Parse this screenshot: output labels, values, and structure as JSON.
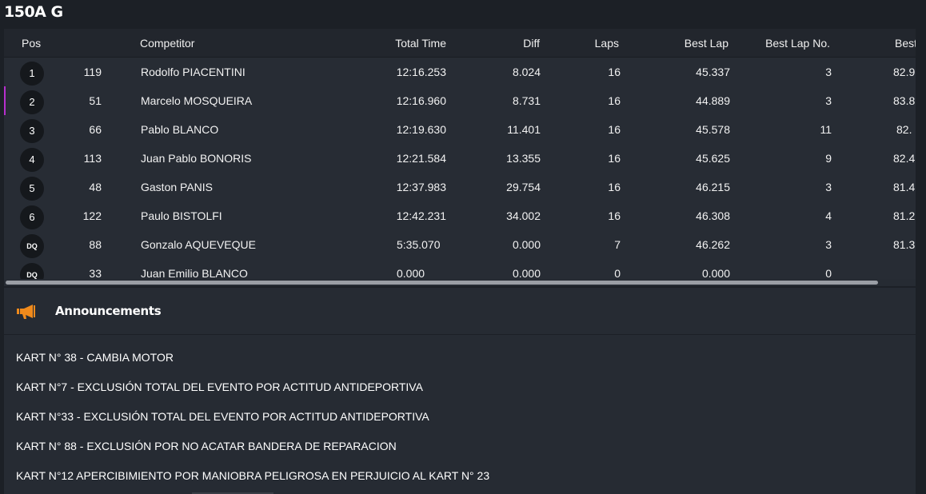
{
  "title": "150A G",
  "table": {
    "headers": {
      "pos": "Pos",
      "competitor": "Competitor",
      "total_time": "Total Time",
      "diff": "Diff",
      "laps": "Laps",
      "best_lap": "Best Lap",
      "best_lap_no": "Best Lap No.",
      "best_speed": "Best"
    },
    "rows": [
      {
        "pos": "1",
        "number": "119",
        "name": "Rodolfo PIACENTINI",
        "total": "12:16.253",
        "diff": "8.024",
        "laps": "16",
        "best": "45.337",
        "best_no": "3",
        "speed": "82.9"
      },
      {
        "pos": "2",
        "number": "51",
        "name": "Marcelo MOSQUEIRA",
        "total": "12:16.960",
        "diff": "8.731",
        "laps": "16",
        "best": "44.889",
        "best_no": "3",
        "speed": "83.8"
      },
      {
        "pos": "3",
        "number": "66",
        "name": "Pablo BLANCO",
        "total": "12:19.630",
        "diff": "11.401",
        "laps": "16",
        "best": "45.578",
        "best_no": "11",
        "speed": "82."
      },
      {
        "pos": "4",
        "number": "113",
        "name": "Juan Pablo BONORIS",
        "total": "12:21.584",
        "diff": "13.355",
        "laps": "16",
        "best": "45.625",
        "best_no": "9",
        "speed": "82.4"
      },
      {
        "pos": "5",
        "number": "48",
        "name": "Gaston PANIS",
        "total": "12:37.983",
        "diff": "29.754",
        "laps": "16",
        "best": "46.215",
        "best_no": "3",
        "speed": "81.4"
      },
      {
        "pos": "6",
        "number": "122",
        "name": "Paulo BISTOLFI",
        "total": "12:42.231",
        "diff": "34.002",
        "laps": "16",
        "best": "46.308",
        "best_no": "4",
        "speed": "81.2"
      },
      {
        "pos": "DQ",
        "number": "88",
        "name": "Gonzalo AQUEVEQUE",
        "total": "5:35.070",
        "diff": "0.000",
        "laps": "7",
        "best": "46.262",
        "best_no": "3",
        "speed": "81.3"
      },
      {
        "pos": "DQ",
        "number": "33",
        "name": "Juan Emilio BLANCO",
        "total": "0.000",
        "diff": "0.000",
        "laps": "0",
        "best": "0.000",
        "best_no": "0",
        "speed": ""
      }
    ]
  },
  "announcements": {
    "title": "Announcements",
    "items": [
      "KART N° 38 - CAMBIA MOTOR",
      "KART N°7 - EXCLUSIÓN TOTAL DEL EVENTO POR ACTITUD ANTIDEPORTIVA",
      "KART N°33 - EXCLUSIÓN TOTAL DEL EVENTO POR ACTITUD ANTIDEPORTIVA",
      "KART N° 88 - EXCLUSIÓN POR NO ACATAR BANDERA DE REPARACION",
      "KART N°12 APERCIBIMIENTO POR MANIOBRA PELIGROSA EN PERJUICIO AL KART N° 23"
    ]
  },
  "colors": {
    "accent_link": "#35b4de",
    "best_lap_highlight": "#c13fd6",
    "megaphone": "#f08a1c"
  },
  "icons": {
    "announcements": "megaphone-icon"
  }
}
